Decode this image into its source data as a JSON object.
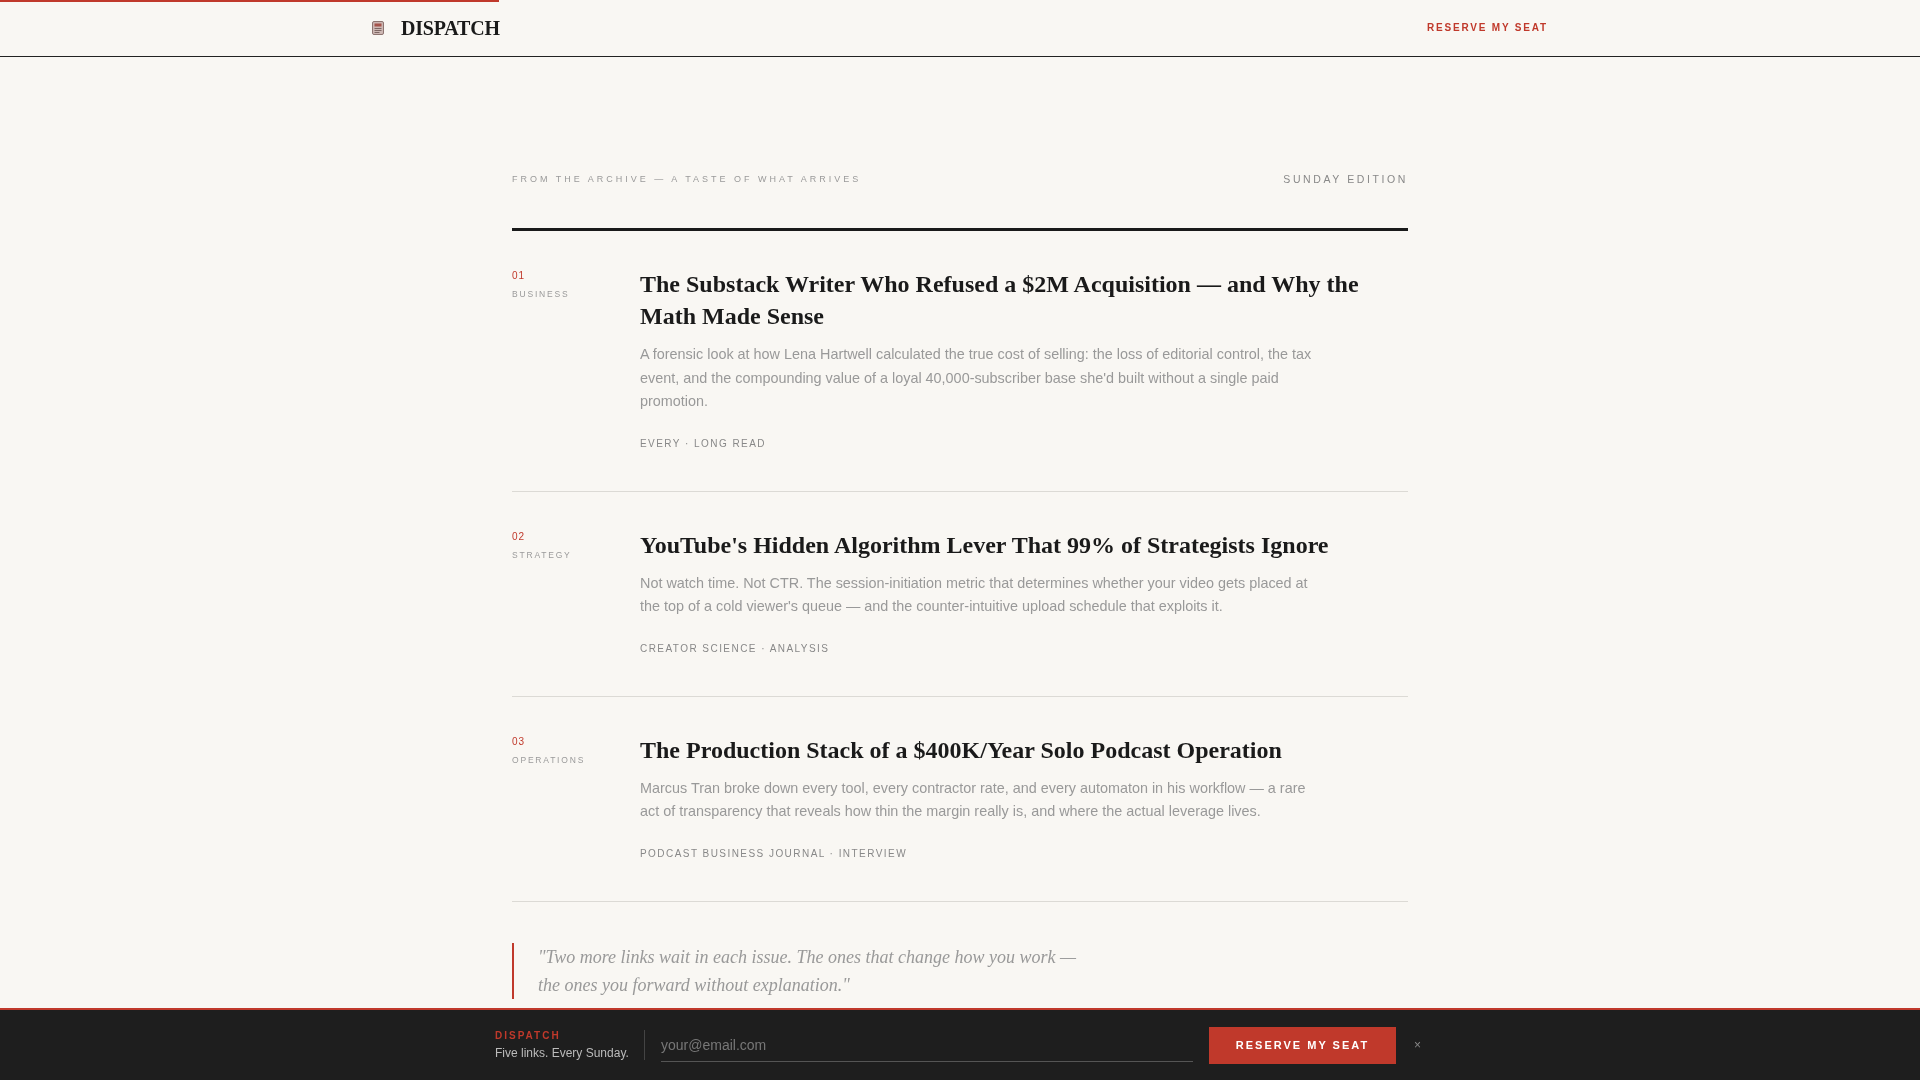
{
  "progress": {
    "level": 0.26
  },
  "header": {
    "logo": "DISPATCH",
    "cta": "RESERVE MY SEAT"
  },
  "archive": {
    "kicker": "FROM THE ARCHIVE — A TASTE OF WHAT ARRIVES",
    "edition": "SUNDAY EDITION"
  },
  "articles": [
    {
      "number": "01",
      "category": "BUSINESS",
      "title": "The Substack Writer Who Refused a $2M Acquisition — and Why the Math Made Sense",
      "summary": "A forensic look at how Lena Hartwell calculated the true cost of selling: the loss of editorial control, the tax event, and the compounding value of a loyal 40,000-subscriber base she'd built without a single paid promotion.",
      "meta": "EVERY · LONG READ"
    },
    {
      "number": "02",
      "category": "STRATEGY",
      "title": "YouTube's Hidden Algorithm Lever That 99% of Strategists Ignore",
      "summary": "Not watch time. Not CTR. The session-initiation metric that determines whether your video gets placed at the top of a cold viewer's queue — and the counter-intuitive upload schedule that exploits it.",
      "meta": "CREATOR SCIENCE · ANALYSIS"
    },
    {
      "number": "03",
      "category": "OPERATIONS",
      "title": "The Production Stack of a $400K/Year Solo Podcast Operation",
      "summary": "Marcus Tran broke down every tool, every contractor rate, and every automaton in his workflow — a rare act of transparency that reveals how thin the margin really is, and where the actual leverage lives.",
      "meta": "PODCAST BUSINESS JOURNAL · INTERVIEW"
    }
  ],
  "quote": "\"Two more links wait in each issue. The ones that change how you work — the ones you forward without explanation.\"",
  "signup_bar": {
    "brand": "DISPATCH",
    "tagline": "Five links. Every Sunday.",
    "email": {
      "placeholder": "your@email.com"
    },
    "button": "RESERVE MY SEAT",
    "close": "×"
  }
}
